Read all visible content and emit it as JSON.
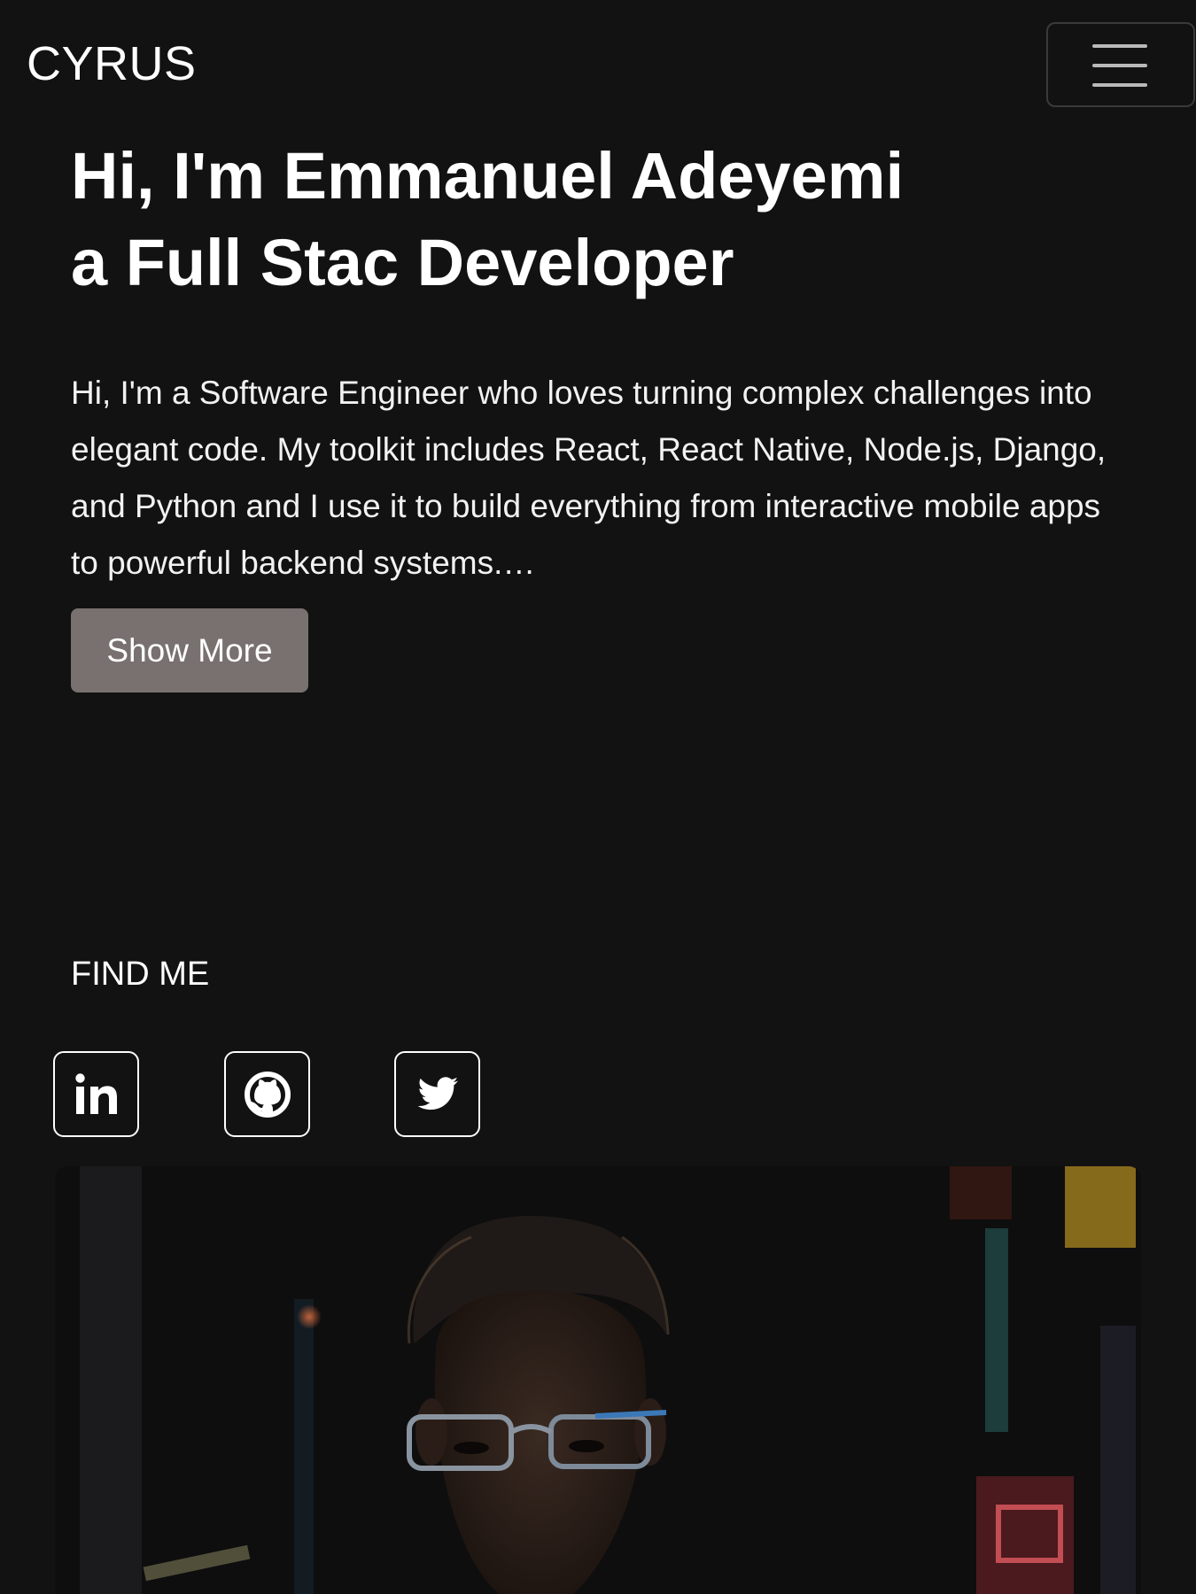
{
  "navbar": {
    "brand": "CYRUS",
    "menu_icon": "hamburger-menu-icon"
  },
  "hero": {
    "title_line1": "Hi, I'm Emmanuel Adeyemi",
    "title_line2": "a Full Stac Developer",
    "intro": "Hi, I'm a Software Engineer who loves turning complex challenges into elegant code. My toolkit includes React, React Native, Node.js, Django, and Python and I use it to build everything from interactive mobile apps to powerful backend systems.…",
    "show_more_label": "Show More"
  },
  "find_me": {
    "heading": "FIND ME",
    "links": [
      {
        "icon": "linkedin-icon"
      },
      {
        "icon": "github-icon"
      },
      {
        "icon": "twitter-icon"
      }
    ]
  },
  "colors": {
    "background": "#121212",
    "text": "#ffffff",
    "button": "#78716f"
  }
}
